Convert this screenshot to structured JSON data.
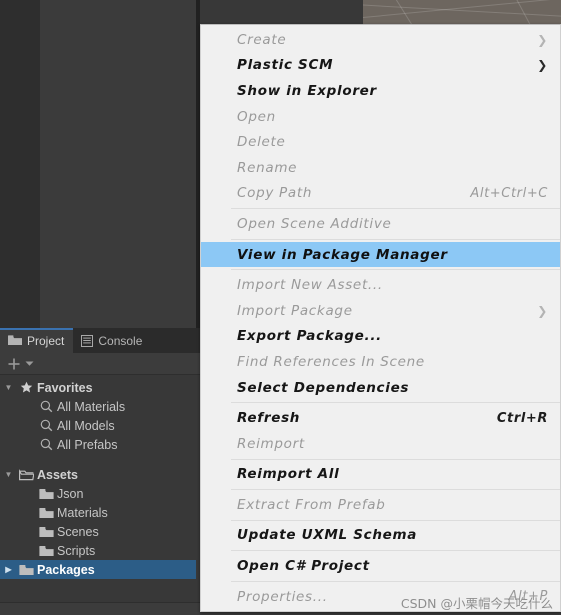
{
  "window": {
    "background_color": "#383838",
    "scene_view_color": "#6d665f"
  },
  "project_panel": {
    "tabs": [
      {
        "label": "Project",
        "icon": "folder-icon",
        "active": true
      },
      {
        "label": "Console",
        "icon": "console-list-icon",
        "active": false
      }
    ],
    "toolbar": {
      "add_label": "+",
      "dropdown_label": "▾"
    },
    "tree": [
      {
        "label": "Favorites",
        "icon": "star-icon",
        "twirl": "▼",
        "depth": 0,
        "bold": true,
        "selected": false
      },
      {
        "label": "All Materials",
        "icon": "search-icon",
        "twirl": "",
        "depth": 1,
        "bold": false,
        "selected": false
      },
      {
        "label": "All Models",
        "icon": "search-icon",
        "twirl": "",
        "depth": 1,
        "bold": false,
        "selected": false
      },
      {
        "label": "All Prefabs",
        "icon": "search-icon",
        "twirl": "",
        "depth": 1,
        "bold": false,
        "selected": false
      },
      {
        "label": "Assets",
        "icon": "folder-open-icon",
        "twirl": "▼",
        "depth": 0,
        "bold": true,
        "selected": false
      },
      {
        "label": "Json",
        "icon": "folder-icon",
        "twirl": "",
        "depth": 1,
        "bold": false,
        "selected": false
      },
      {
        "label": "Materials",
        "icon": "folder-icon",
        "twirl": "",
        "depth": 1,
        "bold": false,
        "selected": false
      },
      {
        "label": "Scenes",
        "icon": "folder-icon",
        "twirl": "",
        "depth": 1,
        "bold": false,
        "selected": false
      },
      {
        "label": "Scripts",
        "icon": "folder-icon",
        "twirl": "",
        "depth": 1,
        "bold": false,
        "selected": false
      },
      {
        "label": "Packages",
        "icon": "folder-icon",
        "twirl": "▶",
        "depth": 0,
        "bold": true,
        "selected": true
      }
    ],
    "selection_color": "#2c5d87",
    "active_tab_accent": "#3a72b0"
  },
  "context_menu": {
    "highlight_color": "#8cc8f5",
    "background_color": "#f0f0f0",
    "items": [
      {
        "label": "Create",
        "shortcut": "",
        "submenu": true,
        "state": "disabled",
        "separator_after": false
      },
      {
        "label": "Plastic SCM",
        "shortcut": "",
        "submenu": true,
        "state": "enabled",
        "separator_after": false
      },
      {
        "label": "Show in Explorer",
        "shortcut": "",
        "submenu": false,
        "state": "enabled",
        "separator_after": false
      },
      {
        "label": "Open",
        "shortcut": "",
        "submenu": false,
        "state": "disabled",
        "separator_after": false
      },
      {
        "label": "Delete",
        "shortcut": "",
        "submenu": false,
        "state": "disabled",
        "separator_after": false
      },
      {
        "label": "Rename",
        "shortcut": "",
        "submenu": false,
        "state": "disabled",
        "separator_after": false
      },
      {
        "label": "Copy Path",
        "shortcut": "Alt+Ctrl+C",
        "submenu": false,
        "state": "disabled",
        "separator_after": true
      },
      {
        "label": "Open Scene Additive",
        "shortcut": "",
        "submenu": false,
        "state": "disabled",
        "separator_after": true
      },
      {
        "label": "View in Package Manager",
        "shortcut": "",
        "submenu": false,
        "state": "highlight",
        "separator_after": true
      },
      {
        "label": "Import New Asset...",
        "shortcut": "",
        "submenu": false,
        "state": "disabled",
        "separator_after": false
      },
      {
        "label": "Import Package",
        "shortcut": "",
        "submenu": true,
        "state": "disabled",
        "separator_after": false
      },
      {
        "label": "Export Package...",
        "shortcut": "",
        "submenu": false,
        "state": "enabled",
        "separator_after": false
      },
      {
        "label": "Find References In Scene",
        "shortcut": "",
        "submenu": false,
        "state": "disabled",
        "separator_after": false
      },
      {
        "label": "Select Dependencies",
        "shortcut": "",
        "submenu": false,
        "state": "enabled",
        "separator_after": true
      },
      {
        "label": "Refresh",
        "shortcut": "Ctrl+R",
        "submenu": false,
        "state": "enabled",
        "separator_after": false
      },
      {
        "label": "Reimport",
        "shortcut": "",
        "submenu": false,
        "state": "disabled",
        "separator_after": true
      },
      {
        "label": "Reimport All",
        "shortcut": "",
        "submenu": false,
        "state": "enabled",
        "separator_after": true
      },
      {
        "label": "Extract From Prefab",
        "shortcut": "",
        "submenu": false,
        "state": "disabled",
        "separator_after": true
      },
      {
        "label": "Update UXML Schema",
        "shortcut": "",
        "submenu": false,
        "state": "enabled",
        "separator_after": true
      },
      {
        "label": "Open C# Project",
        "shortcut": "",
        "submenu": false,
        "state": "enabled",
        "separator_after": true
      },
      {
        "label": "Properties...",
        "shortcut": "Alt+P",
        "submenu": false,
        "state": "disabled",
        "separator_after": false
      }
    ]
  },
  "watermark": {
    "text": "CSDN @小栗帽今天吃什么"
  }
}
